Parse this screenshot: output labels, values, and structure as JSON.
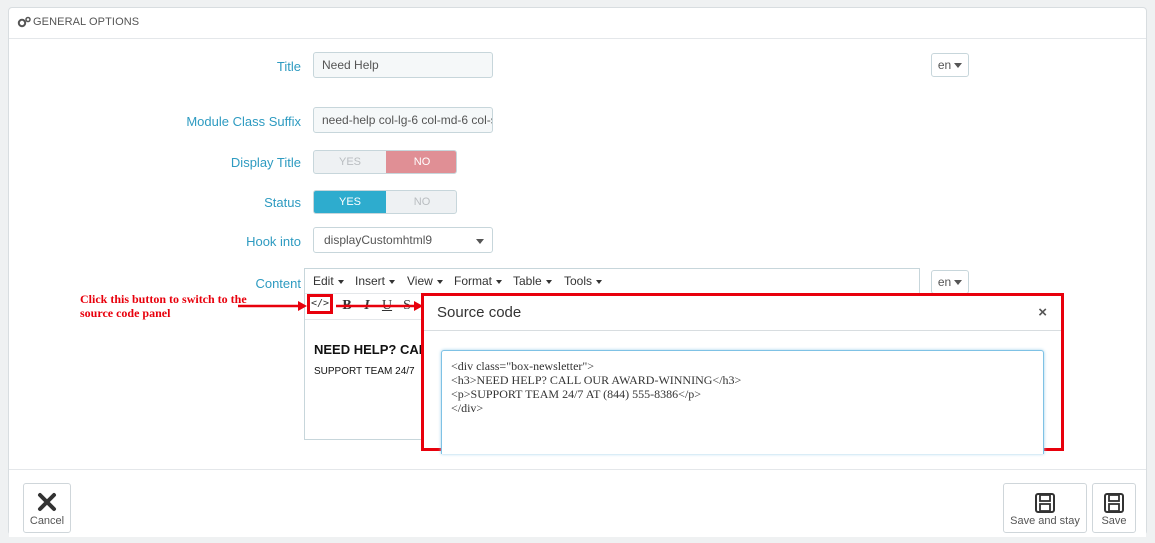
{
  "header": {
    "title": "GENERAL OPTIONS",
    "icon": "gears-icon"
  },
  "fields": {
    "title": {
      "label": "Title",
      "value": "Need Help"
    },
    "suffix": {
      "label": "Module Class Suffix",
      "value": "need-help col-lg-6 col-md-6 col-s"
    },
    "display_title": {
      "label": "Display Title",
      "yes": "YES",
      "no": "NO",
      "selected": "NO"
    },
    "status": {
      "label": "Status",
      "yes": "YES",
      "no": "NO",
      "selected": "YES"
    },
    "hook": {
      "label": "Hook into",
      "value": "displayCustomhtml9"
    },
    "content": {
      "label": "Content"
    }
  },
  "lang": {
    "value": "en"
  },
  "editor": {
    "menus": [
      "Edit",
      "Insert",
      "View",
      "Format",
      "Table",
      "Tools"
    ],
    "source_button": "</>",
    "toolbar": [
      "B",
      "I",
      "U",
      "S"
    ],
    "heading": "NEED HELP? CAL",
    "paragraph": "SUPPORT TEAM 24/7"
  },
  "annotation": "Click this button to switch to the source code panel",
  "dialog": {
    "title": "Source code",
    "close": "×",
    "code_lines": [
      "<div class=\"box-newsletter\">",
      "<h3>NEED HELP? CALL OUR AWARD-WINNING</h3>",
      "<p>SUPPORT TEAM 24/7 AT (844) 555-8386</p>",
      "</div>"
    ]
  },
  "footer": {
    "cancel": "Cancel",
    "save_stay": "Save and stay",
    "save": "Save"
  },
  "colors": {
    "accent_blue": "#2eacce",
    "accent_red": "#e08f95",
    "annotation_red": "#e8000c",
    "label_blue": "#2e9bc1"
  }
}
